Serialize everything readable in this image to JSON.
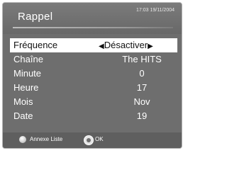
{
  "header": {
    "title": "Rappel",
    "datetime": "17:03 19/11/2004"
  },
  "menu": {
    "items": [
      {
        "label": "Fréquence",
        "value": "Désactiver",
        "selected": true
      },
      {
        "label": "Chaîne",
        "value": "The HITS"
      },
      {
        "label": "Minute",
        "value": "0"
      },
      {
        "label": "Heure",
        "value": "17"
      },
      {
        "label": "Mois",
        "value": "Nov"
      },
      {
        "label": "Date",
        "value": "19"
      }
    ],
    "left_arrow": "◀",
    "right_arrow": "▶"
  },
  "footer": {
    "button1_label": "Annexe Liste",
    "button2_label": "OK"
  },
  "colors": {
    "background": "#6e6e6e",
    "selected_row": "#ffffff",
    "text": "#ffffff"
  }
}
